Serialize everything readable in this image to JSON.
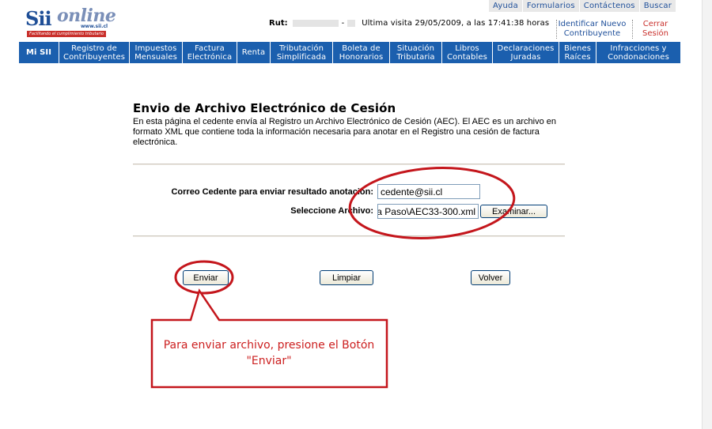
{
  "top_links": [
    "Ayuda",
    "Formularios",
    "Contáctenos",
    "Buscar"
  ],
  "logo": {
    "brand_sii": "Sii",
    "brand_online": "online",
    "url": "www.sii.cl",
    "tagline": "Facilitando el cumplimiento tributario"
  },
  "header": {
    "rut_label": "Rut:",
    "rut_separator": "-",
    "last_visit": "Ultima visita 29/05/2009, a las 17:41:38 horas",
    "identify_link": [
      "Identificar Nuevo",
      "Contribuyente"
    ],
    "logout_link": [
      "Cerrar",
      "Sesión"
    ]
  },
  "nav": [
    {
      "lines": [
        "Mi SII"
      ]
    },
    {
      "lines": [
        "Registro de",
        "Contribuyentes"
      ]
    },
    {
      "lines": [
        "Impuestos",
        "Mensuales"
      ]
    },
    {
      "lines": [
        "Factura",
        "Electrónica"
      ]
    },
    {
      "lines": [
        "Renta"
      ]
    },
    {
      "lines": [
        "Tributación",
        "Simplificada"
      ]
    },
    {
      "lines": [
        "Boleta de",
        "Honorarios"
      ]
    },
    {
      "lines": [
        "Situación",
        "Tributaria"
      ]
    },
    {
      "lines": [
        "Libros",
        "Contables"
      ]
    },
    {
      "lines": [
        "Declaraciones",
        "Juradas"
      ]
    },
    {
      "lines": [
        "Bienes",
        "Raíces"
      ]
    },
    {
      "lines": [
        "Infracciones y",
        "Condonaciones"
      ]
    }
  ],
  "page": {
    "title": "Envio de Archivo Electrónico de Cesión",
    "description": "En esta página el cedente envía al Registro un Archivo Electrónico de Cesión (AEC). El AEC es un archivo en formato XML que contiene toda la información necesaria para anotar en el Registro una cesión de factura electrónica."
  },
  "form": {
    "email_label": "Correo Cedente para enviar resultado anotación:",
    "email_value": "cedente@sii.cl",
    "file_label": "Seleccione Archivo:",
    "file_value": "...a Paso\\AEC33-300.xml",
    "browse_label": "Examinar..."
  },
  "buttons": {
    "send": "Enviar",
    "clear": "Limpiar",
    "back": "Volver"
  },
  "annotation": {
    "callout_text": "Para enviar archivo, presione el Botón \"Enviar\"",
    "color": "#cc1f1f"
  },
  "colors": {
    "nav_bg": "#1b5fae",
    "link": "#1e4f9a",
    "accent_red": "#c9302c"
  }
}
